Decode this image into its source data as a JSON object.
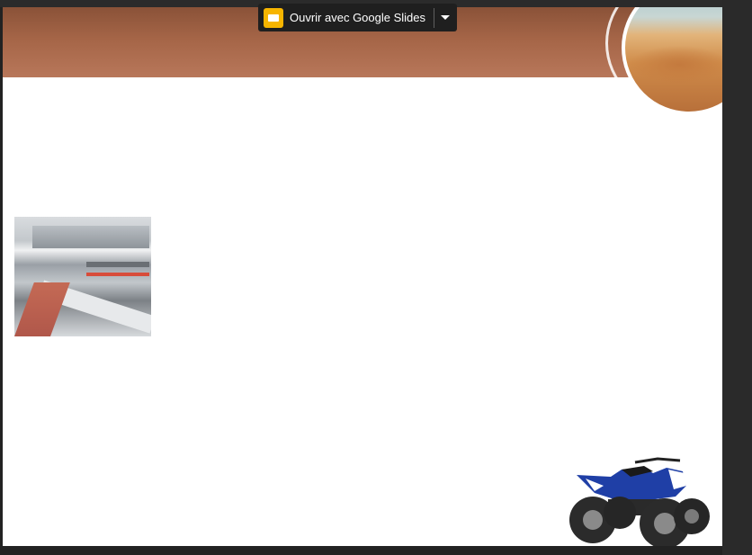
{
  "toolbar": {
    "open_with_label": "Ouvrir avec Google Slides",
    "app_icon": "google-slides-icon",
    "dropdown_icon": "caret-down-icon"
  },
  "slide": {
    "images": [
      "desert-dunes",
      "commercial-kitchen",
      "quad-atv"
    ]
  },
  "colors": {
    "banner_top": "#8a5238",
    "banner_bottom": "#b8775a",
    "slides_brand": "#f7b500",
    "viewer_background": "#222222"
  }
}
